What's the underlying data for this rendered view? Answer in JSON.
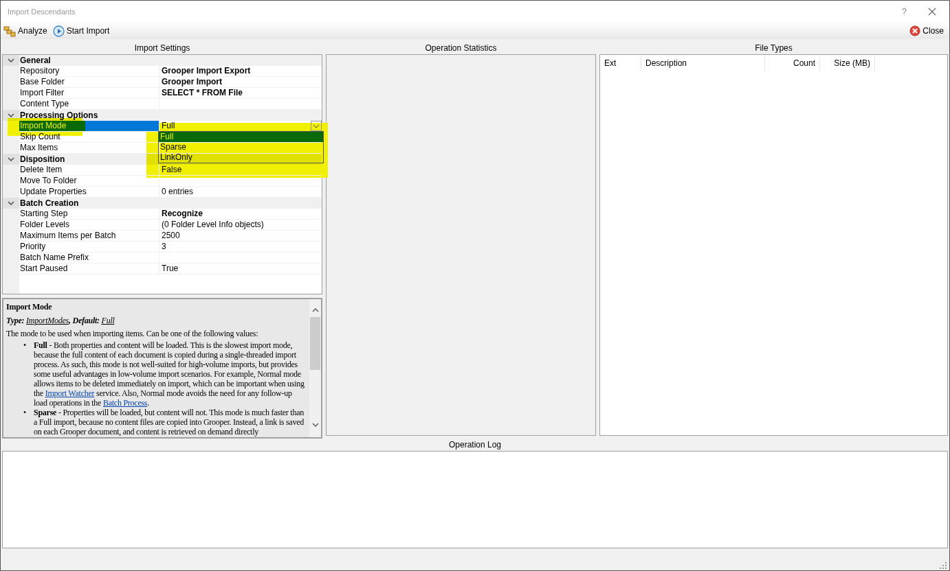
{
  "window": {
    "title": "Import Descendants",
    "help": "?"
  },
  "toolbar": [
    {
      "kind": "analyze",
      "label": "Analyze"
    },
    {
      "kind": "start",
      "label": "Start Import"
    }
  ],
  "close_button": {
    "label": "Close"
  },
  "import_settings": {
    "title": "Import Settings",
    "categories": [
      {
        "name": "General",
        "expanded": true,
        "rows": [
          {
            "name": "Repository",
            "value": "Grooper Import Export",
            "bold": true,
            "selected": false
          },
          {
            "name": "Base Folder",
            "value": "Grooper Import",
            "bold": true,
            "selected": false
          },
          {
            "name": "Import Filter",
            "value": "SELECT * FROM File",
            "bold": true,
            "selected": false
          },
          {
            "name": "Content Type",
            "selected": false
          }
        ]
      },
      {
        "name": "Processing Options",
        "expanded": true,
        "rows": [
          {
            "name": "Import Mode",
            "value": "Full",
            "bold": false,
            "selected": true,
            "dropdown": true
          },
          {
            "name": "Skip Count",
            "selected": false
          },
          {
            "name": "Max Items",
            "selected": false
          }
        ]
      },
      {
        "name": "Disposition",
        "expanded": true,
        "rows": [
          {
            "name": "Delete Item",
            "value": "False",
            "bold": false,
            "selected": false
          },
          {
            "name": "Move To Folder",
            "selected": false
          },
          {
            "name": "Update Properties",
            "value": "0 entries",
            "bold": false,
            "selected": false
          }
        ]
      },
      {
        "name": "Batch Creation",
        "expanded": true,
        "rows": [
          {
            "name": "Starting Step",
            "value": "Recognize",
            "bold": true,
            "selected": false
          },
          {
            "name": "Folder Levels",
            "value": "(0 Folder Level Info objects)",
            "bold": false,
            "selected": false
          },
          {
            "name": "Maximum Items per Batch",
            "value": "2500",
            "bold": false,
            "selected": false
          },
          {
            "name": "Priority",
            "value": "3",
            "bold": false,
            "selected": false
          },
          {
            "name": "Batch Name Prefix",
            "selected": false
          },
          {
            "name": "Start Paused",
            "value": "True",
            "bold": false,
            "selected": false
          }
        ]
      }
    ],
    "dropdown_options": [
      {
        "label": "Full",
        "selected": true
      },
      {
        "label": "Sparse",
        "selected": false
      },
      {
        "label": "LinkOnly",
        "selected": false
      }
    ],
    "help": {
      "heading": "Import Mode",
      "type_line": [
        {
          "text": "Type: "
        },
        {
          "link": "ImportModes"
        },
        {
          "text": ", Default: "
        },
        {
          "link": "Full"
        }
      ],
      "intro": "The mode to be used when importing items. Can be one of the following values:",
      "bullets": [
        {
          "marker": "•",
          "segments": [
            {
              "text": "**Full** - Both properties and content will be loaded. This is the slowest import mode, because the full content of each document is copied during a single-threaded import process. As such, this mode is not well-suited for high-volume imports, but provides some useful advantages in low-volume import scenarios. For example, Normal mode allows items to be deleted immediately on import, which can be important when using the "
            },
            {
              "link": "Import Watcher"
            },
            {
              "text": " service. Also, Normal mode avoids the need for any follow-up load operations in the "
            },
            {
              "link": "Batch Process"
            },
            {
              "text": "."
            }
          ]
        },
        {
          "marker": "•",
          "segments": [
            {
              "text": "**Sparse** - Properties will be loaded, but content will not. This mode is much faster than a Full import, because no content files are copied into Grooper. Instead, a link is saved on each Grooper document, and content is retrieved on demand directly"
            }
          ]
        }
      ]
    }
  },
  "operation_statistics": {
    "title": "Operation Statistics"
  },
  "file_types": {
    "title": "File Types",
    "columns": [
      {
        "label": "Ext"
      },
      {
        "label": "Description"
      },
      {
        "label": "Count"
      },
      {
        "label": "Size (MB)"
      }
    ]
  },
  "operation_log": {
    "title": "Operation Log"
  }
}
